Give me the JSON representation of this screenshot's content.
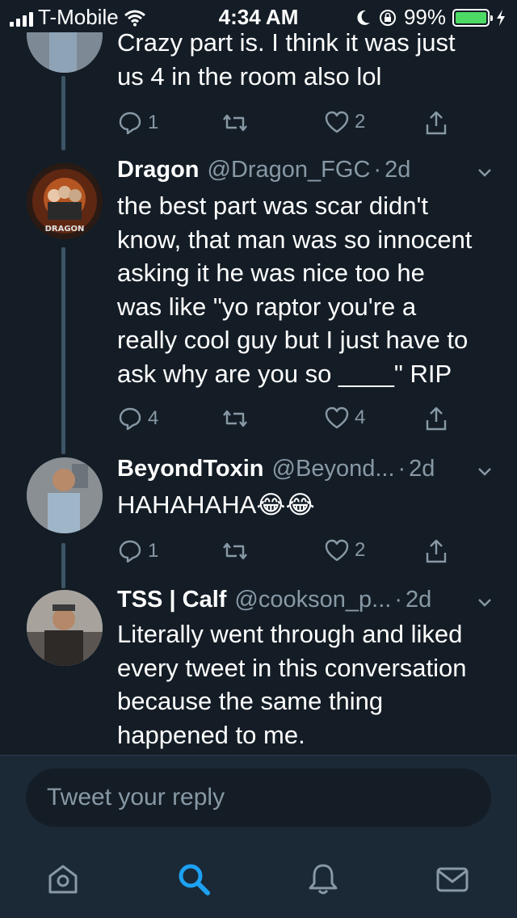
{
  "status_bar": {
    "carrier": "T-Mobile",
    "time": "4:34 AM",
    "battery": "99%",
    "battery_level": 0.99
  },
  "tweets": [
    {
      "name": "",
      "handle": "",
      "time": "",
      "text_lines": [
        "Crazy part is. I think it was just",
        "us 4 in the room also lol"
      ],
      "replies": "1",
      "retweets": "",
      "likes": "2"
    },
    {
      "name": "Dragon",
      "handle": "@Dragon_FGC",
      "time": "2d",
      "avatar_label": "DRAGON",
      "text_lines": [
        "the best part was scar didn't",
        "know, that man was so innocent",
        "asking it he was nice too he",
        "was like \"yo raptor you're a",
        "really cool guy but I just have to",
        "ask why are you so ____\" RIP"
      ],
      "replies": "4",
      "retweets": "",
      "likes": "4"
    },
    {
      "name": "BeyondToxin",
      "handle": "@Beyond...",
      "time": "2d",
      "text_lines": [
        "HAHAHAHA😂😂"
      ],
      "replies": "1",
      "retweets": "",
      "likes": "2"
    },
    {
      "name": "TSS | Calf",
      "handle": "@cookson_p...",
      "time": "2d",
      "text_lines": [
        "Literally went through and liked",
        "every tweet in this conversation",
        "because the same thing",
        "happened to me."
      ]
    }
  ],
  "reply_box": {
    "placeholder": "Tweet your reply"
  },
  "tab_bar": {
    "icons": [
      "home-icon",
      "search-icon",
      "notifications-icon",
      "messages-icon"
    ],
    "active": "search-icon"
  },
  "colors": {
    "background": "#141d26",
    "secondary_text": "#8899a6",
    "accent": "#1da1f2",
    "battery": "#4cd964"
  }
}
